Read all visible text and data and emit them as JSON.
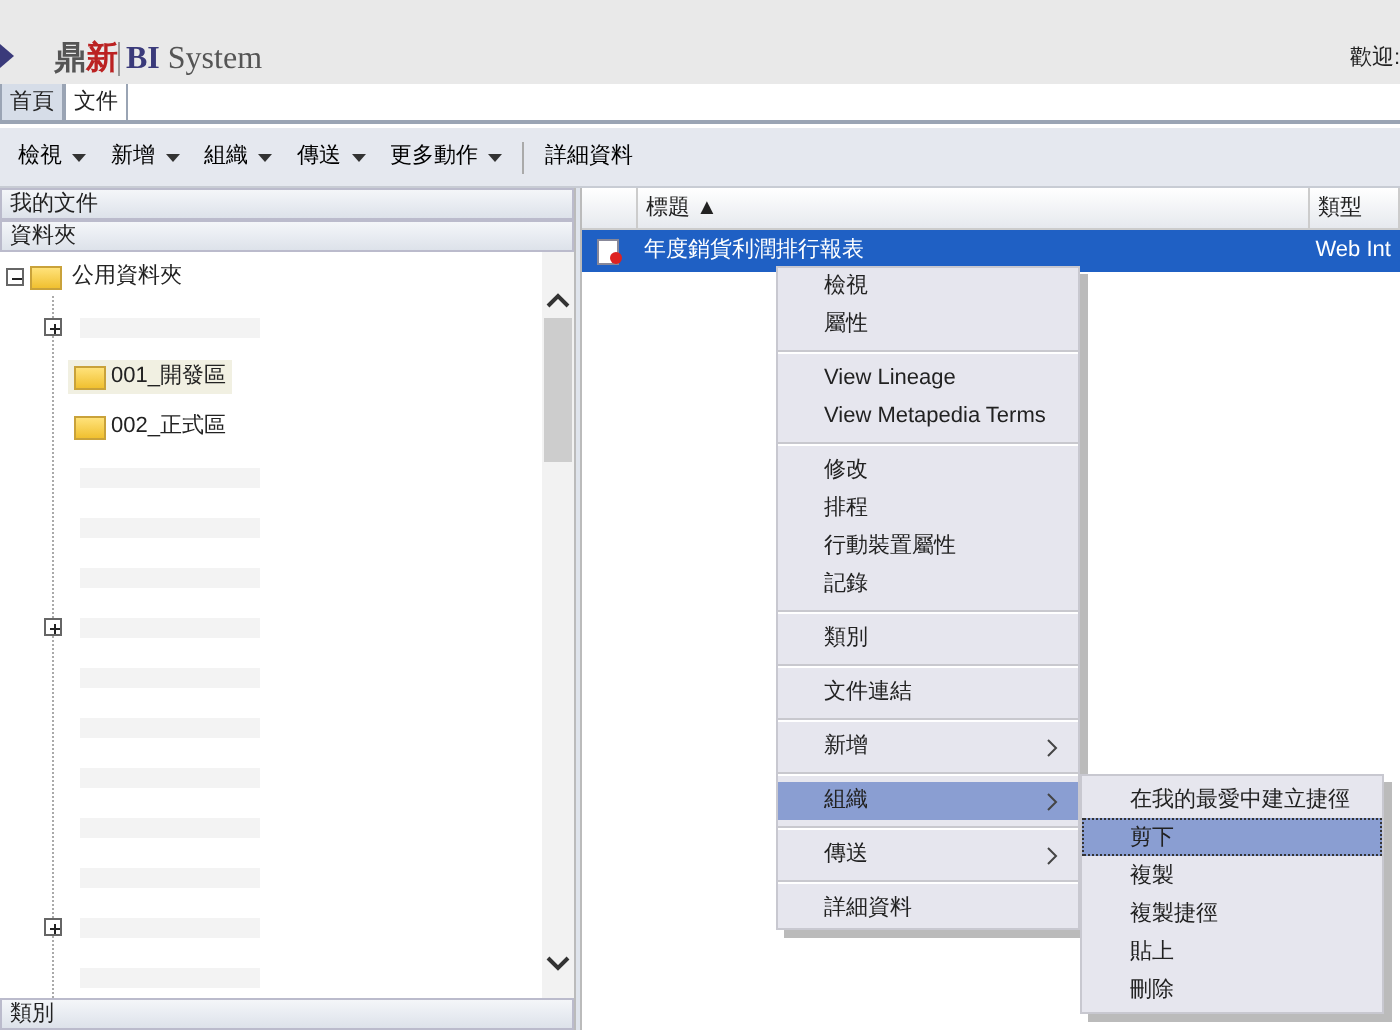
{
  "header": {
    "logo_cn": "鼎新",
    "logo_bi": "BI",
    "logo_system": "System",
    "welcome": "歡迎:"
  },
  "tabs": [
    {
      "label": "首頁",
      "selected": true
    },
    {
      "label": "文件",
      "selected": false
    }
  ],
  "toolbar": [
    {
      "label": "檢視",
      "dropdown": true
    },
    {
      "label": "新增",
      "dropdown": true
    },
    {
      "label": "組織",
      "dropdown": true
    },
    {
      "label": "傳送",
      "dropdown": true
    },
    {
      "label": "更多動作",
      "dropdown": true
    },
    {
      "kind": "separator"
    },
    {
      "label": "詳細資料",
      "dropdown": false
    }
  ],
  "sidebar": {
    "sections": [
      "我的文件",
      "資料夾"
    ],
    "bottom_section": "類別",
    "tree": {
      "label": "公用資料夾",
      "expanded": true,
      "children": [
        {
          "kind": "obscured",
          "expandable": true
        },
        {
          "kind": "folder",
          "label": "001_開發區",
          "selected": true
        },
        {
          "kind": "folder",
          "label": "002_正式區",
          "selected": false
        },
        {
          "kind": "obscured",
          "expandable": false
        },
        {
          "kind": "obscured",
          "expandable": false
        },
        {
          "kind": "obscured",
          "expandable": false
        },
        {
          "kind": "obscured",
          "expandable": true
        },
        {
          "kind": "obscured",
          "expandable": false
        },
        {
          "kind": "obscured",
          "expandable": false
        },
        {
          "kind": "obscured",
          "expandable": false
        },
        {
          "kind": "obscured",
          "expandable": false
        },
        {
          "kind": "obscured",
          "expandable": false
        },
        {
          "kind": "obscured",
          "expandable": true
        },
        {
          "kind": "obscured",
          "expandable": false
        }
      ]
    }
  },
  "table": {
    "columns": [
      "標題 ▲",
      "類型"
    ],
    "rows": [
      {
        "cells": [
          "年度銷貨利潤排行報表",
          "Web Int"
        ],
        "selected": true
      }
    ]
  },
  "context_menu": {
    "items": [
      {
        "kind": "item",
        "label": "檢視"
      },
      {
        "kind": "item",
        "label": "屬性"
      },
      {
        "kind": "separator"
      },
      {
        "kind": "item",
        "label": "View Lineage"
      },
      {
        "kind": "item",
        "label": "View Metapedia Terms"
      },
      {
        "kind": "separator"
      },
      {
        "kind": "item",
        "label": "修改"
      },
      {
        "kind": "item",
        "label": "排程"
      },
      {
        "kind": "item",
        "label": "行動裝置屬性"
      },
      {
        "kind": "item",
        "label": "記錄"
      },
      {
        "kind": "separator"
      },
      {
        "kind": "item",
        "label": "類別"
      },
      {
        "kind": "separator"
      },
      {
        "kind": "item",
        "label": "文件連結"
      },
      {
        "kind": "separator"
      },
      {
        "kind": "submenu",
        "label": "新增",
        "selected": false
      },
      {
        "kind": "separator"
      },
      {
        "kind": "submenu",
        "label": "組織",
        "selected": true
      },
      {
        "kind": "separator"
      },
      {
        "kind": "submenu",
        "label": "傳送",
        "selected": false
      },
      {
        "kind": "separator"
      },
      {
        "kind": "item",
        "label": "詳細資料"
      }
    ]
  },
  "submenu": {
    "items": [
      {
        "label": "在我的最愛中建立捷徑",
        "selected": false
      },
      {
        "label": "剪下",
        "selected": true
      },
      {
        "label": "複製",
        "selected": false
      },
      {
        "label": "複製捷徑",
        "selected": false
      },
      {
        "label": "貼上",
        "selected": false
      },
      {
        "label": "刪除",
        "selected": false
      }
    ]
  }
}
